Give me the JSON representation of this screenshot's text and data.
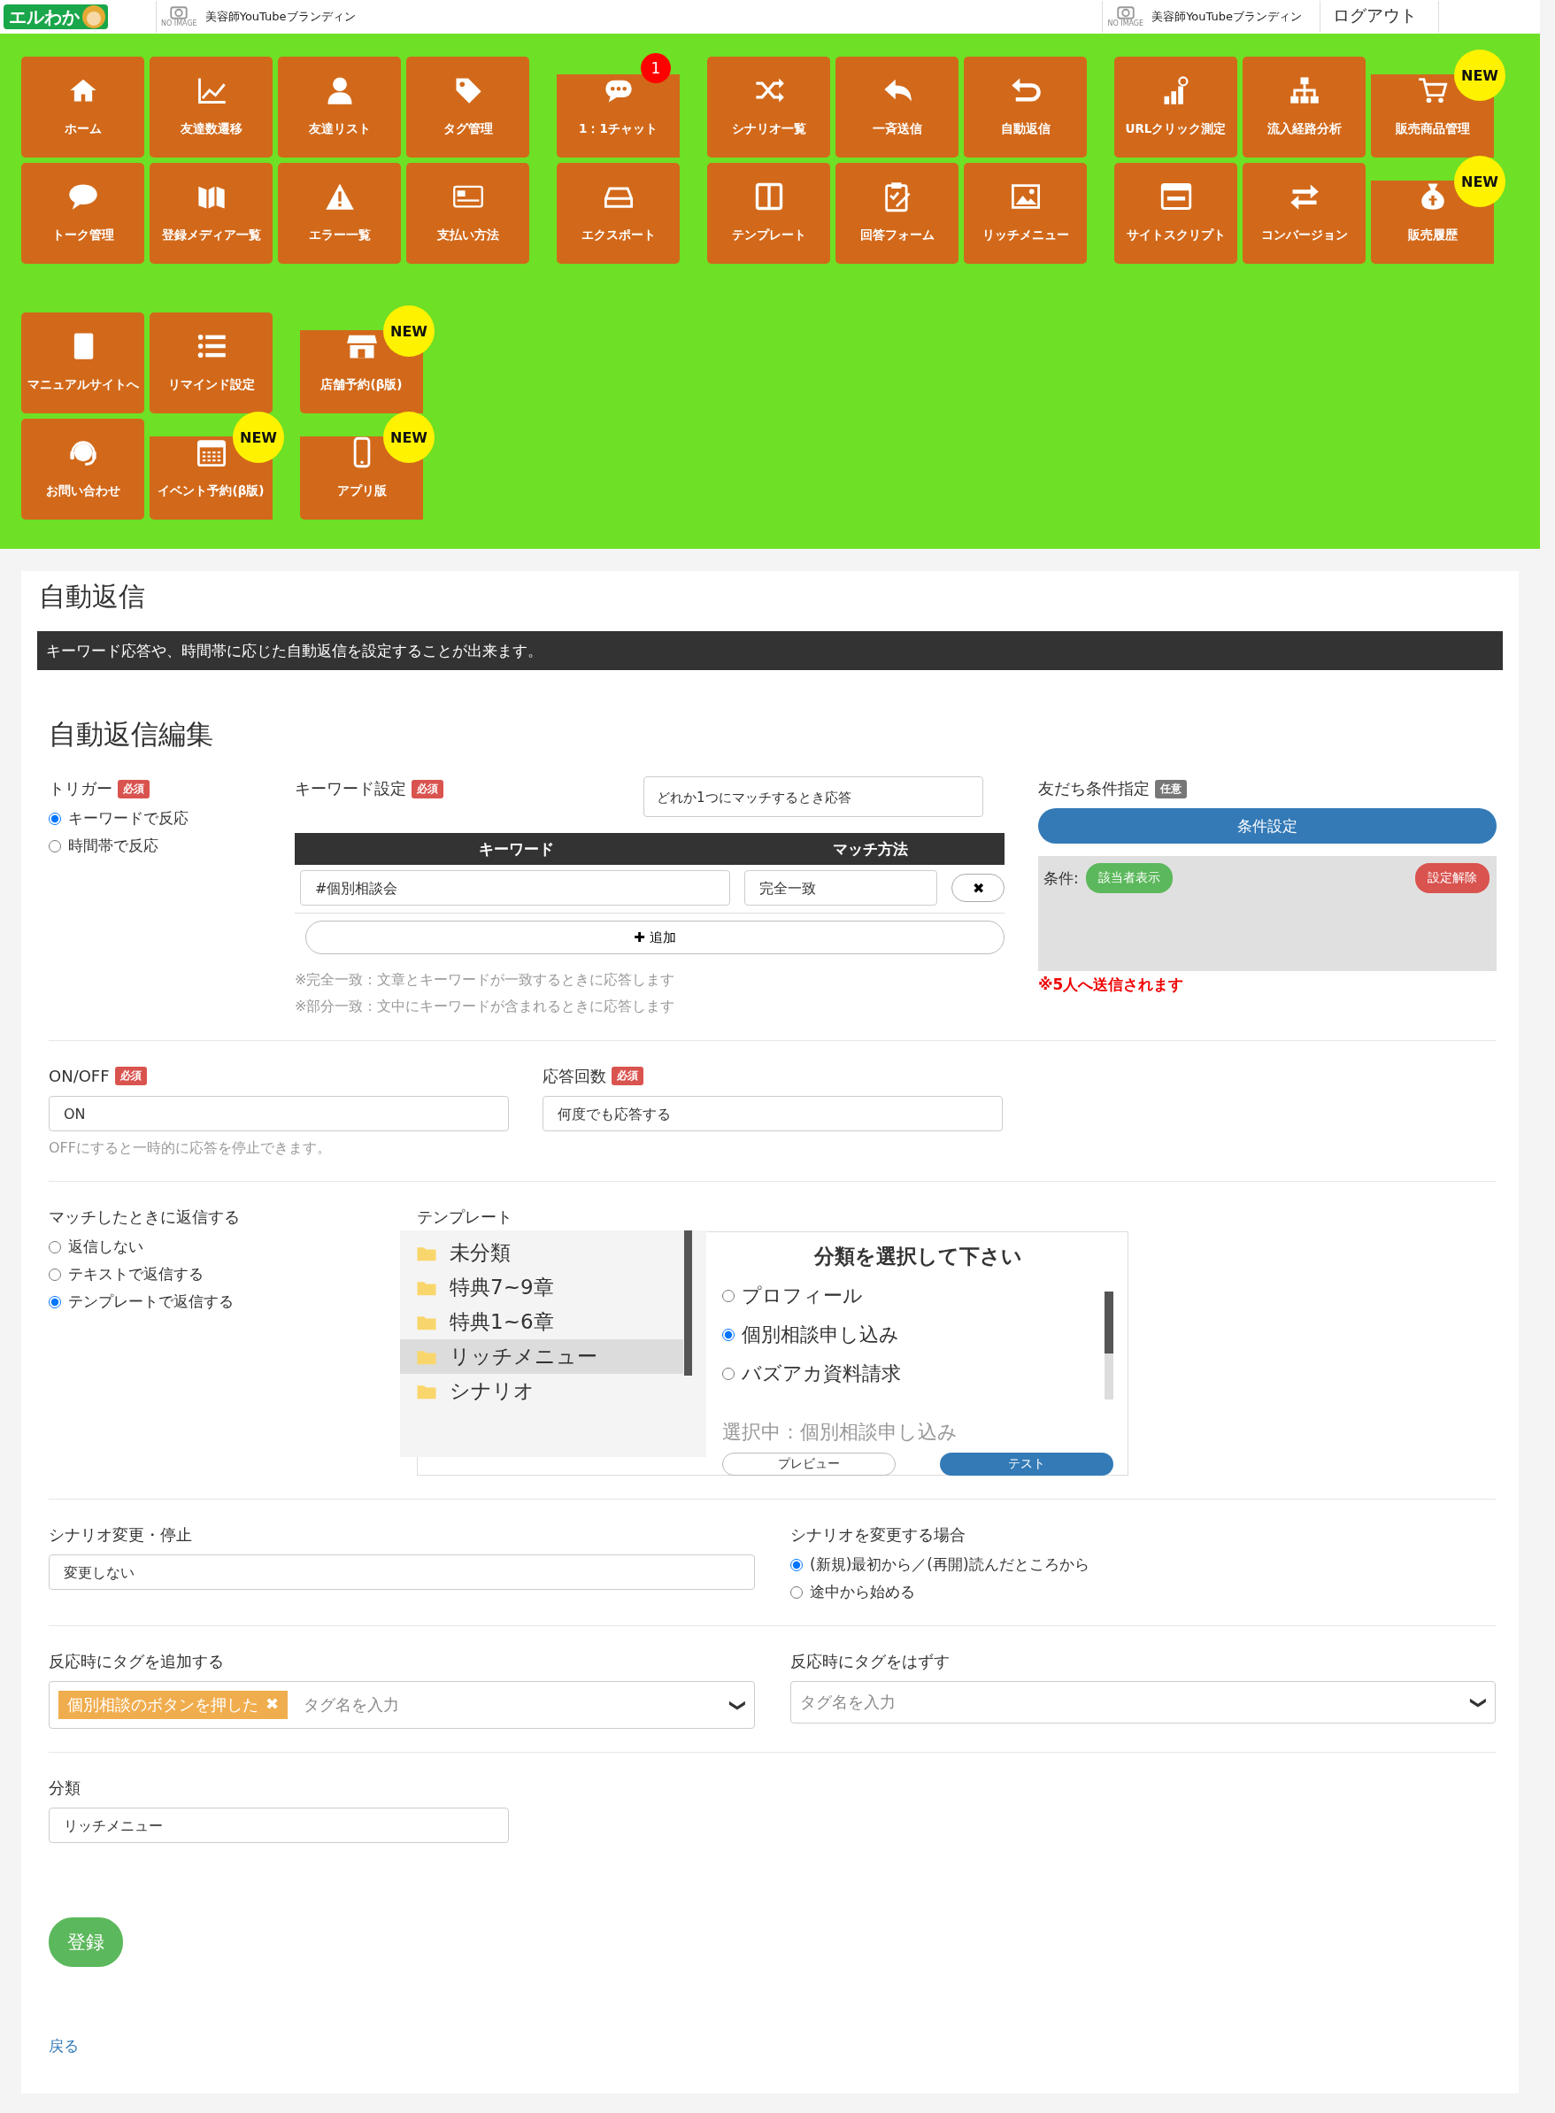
{
  "header": {
    "logo": "エルわか",
    "accounts": [
      {
        "avatar_label": "NO IMAGE",
        "name": "美容師YouTubeブランディン"
      },
      {
        "avatar_label": "NO IMAGE",
        "name": "美容師YouTubeブランディン"
      }
    ],
    "logout": "ログアウト"
  },
  "menu": {
    "sections": [
      {
        "rows": [
          {
            "groups": [
              {
                "tiles": [
                  {
                    "label": "ホーム"
                  },
                  {
                    "label": "友達数遷移"
                  },
                  {
                    "label": "友達リスト"
                  },
                  {
                    "label": "タグ管理"
                  }
                ]
              },
              {
                "tiles": [
                  {
                    "label": "1：1チャット",
                    "badge": {
                      "text": "1",
                      "color": "#ff0000"
                    }
                  }
                ]
              },
              {
                "tiles": [
                  {
                    "label": "シナリオ一覧"
                  },
                  {
                    "label": "一斉送信"
                  },
                  {
                    "label": "自動返信"
                  }
                ]
              },
              {
                "tiles": [
                  {
                    "label": "URLクリック測定"
                  },
                  {
                    "label": "流入経路分析"
                  },
                  {
                    "label": "販売商品管理",
                    "badge": {
                      "text": "NEW",
                      "color": "#fff200"
                    }
                  }
                ]
              }
            ]
          },
          {
            "groups": [
              {
                "tiles": [
                  {
                    "label": "トーク管理"
                  },
                  {
                    "label": "登録メディア一覧"
                  },
                  {
                    "label": "エラー一覧"
                  },
                  {
                    "label": "支払い方法"
                  }
                ]
              },
              {
                "tiles": [
                  {
                    "label": "エクスポート"
                  }
                ]
              },
              {
                "tiles": [
                  {
                    "label": "テンプレート"
                  },
                  {
                    "label": "回答フォーム"
                  },
                  {
                    "label": "リッチメニュー"
                  }
                ]
              },
              {
                "tiles": [
                  {
                    "label": "サイトスクリプト"
                  },
                  {
                    "label": "コンバージョン"
                  },
                  {
                    "label": "販売履歴",
                    "badge": {
                      "text": "NEW",
                      "color": "#fff200"
                    }
                  }
                ]
              }
            ]
          }
        ]
      },
      {
        "rows": [
          {
            "groups": [
              {
                "tiles": [
                  {
                    "label": "マニュアルサイトへ"
                  },
                  {
                    "label": "リマインド設定"
                  }
                ]
              },
              {
                "tiles": [
                  {
                    "label": "店舗予約(β版)",
                    "badge": {
                      "text": "NEW",
                      "color": "#fff200"
                    }
                  }
                ]
              }
            ]
          },
          {
            "groups": [
              {
                "tiles": [
                  {
                    "label": "お問い合わせ"
                  },
                  {
                    "label": "イベント予約(β版)",
                    "badge": {
                      "text": "NEW",
                      "color": "#fff200"
                    }
                  }
                ]
              },
              {
                "tiles": [
                  {
                    "label": "アプリ版",
                    "badge": {
                      "text": "NEW",
                      "color": "#fff200"
                    }
                  }
                ]
              }
            ]
          }
        ]
      }
    ]
  },
  "page": {
    "title": "自動返信",
    "description": "キーワード応答や、時間帯に応じた自動返信を設定することが出来ます。",
    "form_title": "自動返信編集"
  },
  "trigger": {
    "label": "トリガー",
    "badge": "必須",
    "options": [
      {
        "label": "キーワードで反応",
        "selected": true
      },
      {
        "label": "時間帯で反応",
        "selected": false
      }
    ]
  },
  "keywords": {
    "label": "キーワード設定",
    "badge": "必須",
    "match_mode": "どれか1つにマッチするとき応答",
    "columns": [
      "キーワード",
      "マッチ方法"
    ],
    "rows": [
      {
        "keyword": "#個別相談会",
        "match": "完全一致",
        "delete": "✖"
      }
    ],
    "add_button": "✚ 追加",
    "notes": [
      "※完全一致：文章とキーワードが一致するときに応答します",
      "※部分一致：文中にキーワードが含まれるときに応答します"
    ]
  },
  "friend_conditions": {
    "label": "友だち条件指定",
    "badge": "任意",
    "button": "条件設定",
    "conditions_label": "条件:",
    "show_button": "該当者表示",
    "clear_button": "設定解除",
    "notice": "※5人へ送信されます"
  },
  "on_off": {
    "label": "ON/OFF",
    "badge": "必須",
    "value": "ON",
    "hint": "OFFにすると一時的に応答を停止できます。"
  },
  "reply_count": {
    "label": "応答回数",
    "badge": "必須",
    "value": "何度でも応答する"
  },
  "reply_mode": {
    "label": "マッチしたときに返信する",
    "options": [
      {
        "label": "返信しない",
        "selected": false
      },
      {
        "label": "テキストで返信する",
        "selected": false
      },
      {
        "label": "テンプレートで返信する",
        "selected": true
      }
    ]
  },
  "template": {
    "label": "テンプレート",
    "folders": [
      {
        "name": "未分類",
        "selected": false
      },
      {
        "name": "特典7~9章",
        "selected": false
      },
      {
        "name": "特典1~6章",
        "selected": false
      },
      {
        "name": "リッチメニュー",
        "selected": true
      },
      {
        "name": "シナリオ",
        "selected": false
      }
    ],
    "panel_title": "分類を選択して下さい",
    "items": [
      {
        "label": "プロフィール",
        "selected": false
      },
      {
        "label": "個別相談申し込み",
        "selected": true
      },
      {
        "label": "バズアカ資料請求",
        "selected": false
      }
    ],
    "selection": "選択中：個別相談申し込み",
    "preview_button": "プレビュー",
    "test_button": "テスト"
  },
  "scenario": {
    "label": "シナリオ変更・停止",
    "value": "変更しない"
  },
  "scenario_start": {
    "label": "シナリオを変更する場合",
    "options": [
      {
        "label": "(新規)最初から／(再開)読んだところから",
        "selected": true
      },
      {
        "label": "途中から始める",
        "selected": false
      }
    ]
  },
  "add_tags": {
    "label": "反応時にタグを追加する",
    "tags": [
      {
        "name": "個別相談のボタンを押した",
        "remove": "✖"
      }
    ],
    "placeholder": "タグ名を入力",
    "caret": "❯"
  },
  "remove_tags": {
    "label": "反応時にタグをはずす",
    "placeholder": "タグ名を入力",
    "caret": "❯"
  },
  "category": {
    "label": "分類",
    "value": "リッチメニュー"
  },
  "submit": "登録",
  "back_link": "戻る"
}
